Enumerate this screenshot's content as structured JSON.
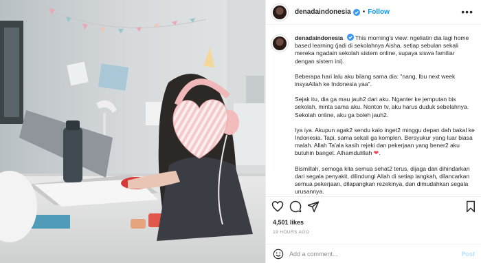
{
  "post": {
    "username": "denadaindonesia",
    "follow_label": "Follow",
    "dot": "•",
    "more": "•••"
  },
  "caption": {
    "username": "denadaindonesia",
    "p1": "This morning's view: ngeliatin dia lagi home based learning (jadi di sekolahnya Aisha, setiap sebulan sekali mereka ngadain sekolah sistem online, supaya siswa familiar dengan sistem ini).",
    "p2": "Beberapa hari lalu aku bilang sama dia: \"nang, Ibu next week insyaAllah ke Indonesia yaa\".",
    "p3": "Sejak itu, dia ga mau jauh2 dari aku. Nganter ke jemputan bis sekolah, minta sama aku. Nonton tv, aku harus duduk sebelahnya. Sekolah online, aku ga boleh jauh2.",
    "p4": "Iya iya. Akupun agak2 sendu kalo inget2 minggu depan dah bakal ke Indonesia. Tapi, sama sekali ga komplen. Bersyukur yang luar biasa malah. Allah Ta'ala kasih rejeki dan pekerjaan yang bener2 aku butuhin banget. Alhamdulillah",
    "heart": "❤",
    "p5": "Bismillah, semoga kita semua sehat2 terus, dijaga dan dihindarkan dari segala penyakit, dilindungi Allah di setiap langkah, dilancarkan semua pekerjaan, dilapangkan rezekinya, dan dimudahkan segala urusannya."
  },
  "stats": {
    "likes": "4,501 likes",
    "timestamp": "19 HOURS AGO"
  },
  "comment": {
    "placeholder": "Add a comment...",
    "post_label": "Post"
  },
  "icons": {
    "like": "heart-outline-icon",
    "comment": "comment-bubble-icon",
    "share": "paper-plane-icon",
    "save": "bookmark-icon",
    "emoji": "smiley-icon",
    "verified": "verified-badge-icon"
  },
  "colors": {
    "link_blue": "#0095f6",
    "post_disabled": "#b2dffc",
    "verified": "#3897f0",
    "heart_red": "#ed4956",
    "muted": "#8e8e8e"
  }
}
